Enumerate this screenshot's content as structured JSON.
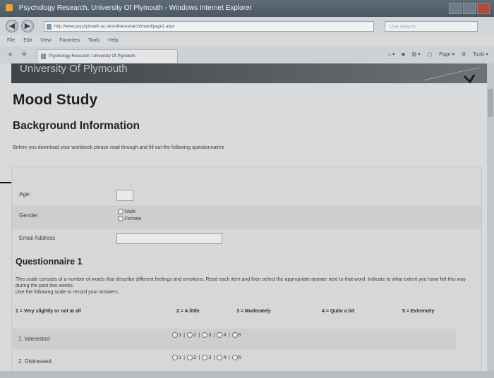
{
  "window": {
    "title": "Psychology Research, University Of Plymouth - Windows Internet Explorer"
  },
  "addressbar": {
    "url": "http://www.psy.plymouth.ac.uk/onlineresearch/mood/page1.aspx",
    "search_placeholder": "Live Search"
  },
  "menu": {
    "items": [
      "File",
      "Edit",
      "View",
      "Favorites",
      "Tools",
      "Help"
    ]
  },
  "tab": {
    "label": "Psychology Research, University Of Plymouth"
  },
  "commandbar": {
    "page_label": "Page",
    "tools_label": "Tools"
  },
  "page": {
    "banner_text": "University Of Plymouth",
    "title": "Mood Study",
    "subtitle": "Background Information",
    "intro": "Before you download your workbook please read through and fill out the following questionnaires"
  },
  "form": {
    "age_label": "Age:",
    "gender_label": "Gender",
    "gender_options": [
      "Male",
      "Female"
    ],
    "email_label": "Email Address"
  },
  "questionnaire": {
    "heading": "Questionnaire 1",
    "description_1": "This scale consists of a number of words that describe different feelings and emotions. Read each item and then select the appropriate answer next to that word. Indicate to what extent you have felt this way during the past two weeks.",
    "description_2": "Use the following scale to record your answers.",
    "scale": [
      "1 = Very slightly or not at all",
      "2 = A little",
      "3 = Moderately",
      "4 = Quite a bit",
      "5 = Extremely"
    ],
    "items": [
      {
        "label": "1. Interested",
        "options": [
          "1",
          "2",
          "3",
          "4",
          "5"
        ]
      },
      {
        "label": "2. Distressed.",
        "options": [
          "1",
          "2",
          "3",
          "4",
          "5"
        ]
      }
    ]
  }
}
